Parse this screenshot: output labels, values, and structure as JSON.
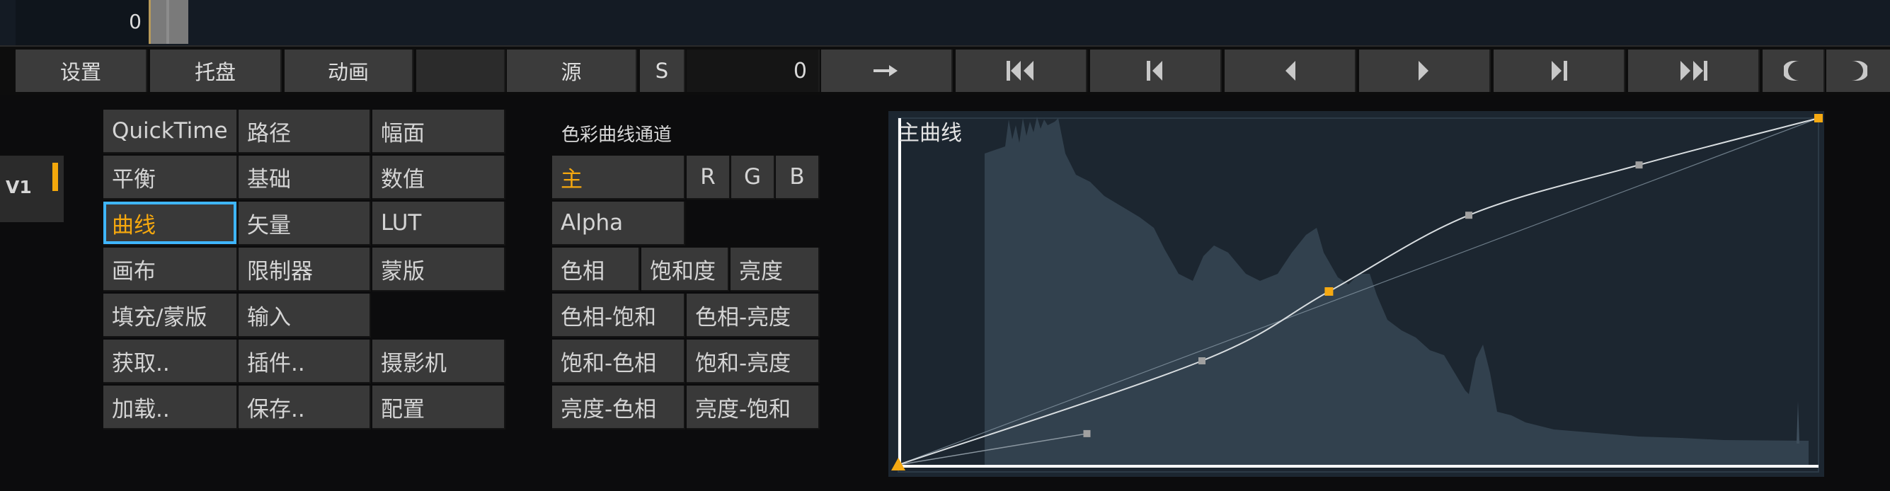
{
  "timeline": {
    "frame": "0"
  },
  "toolbar": {
    "settings": "设置",
    "tray": "托盘",
    "animation": "动画",
    "source": "源",
    "s": "S",
    "field_value": "0",
    "buttons": [
      "arrow-right-icon",
      "skip-to-start-icon",
      "prev-keyframe-icon",
      "prev-frame-icon",
      "next-frame-icon",
      "next-keyframe-icon",
      "skip-to-end-icon",
      "in-point-icon",
      "out-point-icon"
    ]
  },
  "layer": {
    "label": "V1"
  },
  "functions": {
    "quicktime": "QuickTime",
    "path": "路径",
    "frame": "幅面",
    "balance": "平衡",
    "basic": "基础",
    "numeric": "数值",
    "curves": "曲线",
    "vector": "矢量",
    "lut": "LUT",
    "canvas": "画布",
    "limiter": "限制器",
    "mask": "蒙版",
    "fill_mask": "填充/蒙版",
    "input": "输入",
    "grab": "获取..",
    "plugin": "插件..",
    "camera": "摄影机",
    "load": "加载..",
    "save": "保存..",
    "config": "配置",
    "active": "curves",
    "active_color": "#f6a80e",
    "highlight_color": "#3fb6ff"
  },
  "channels": {
    "title": "色彩曲线通道",
    "master": "主",
    "r": "R",
    "g": "G",
    "b": "B",
    "alpha": "Alpha",
    "hue": "色相",
    "saturation": "饱和度",
    "luma": "亮度",
    "hue_sat": "色相-饱和",
    "hue_luma": "色相-亮度",
    "sat_hue": "饱和-色相",
    "sat_luma": "饱和-亮度",
    "luma_hue": "亮度-色相",
    "luma_sat": "亮度-饱和",
    "selected": "master"
  },
  "curve": {
    "title": "主曲线",
    "points": [
      [
        0,
        0
      ],
      [
        0.33,
        0.3
      ],
      [
        0.468,
        0.5
      ],
      [
        0.62,
        0.72
      ],
      [
        0.805,
        0.865
      ],
      [
        1,
        1
      ]
    ],
    "tangent_handles": [
      [
        0.205,
        0.09
      ],
      [
        0.62,
        0.72
      ]
    ],
    "selected_point_color": "#f5a912",
    "point_color": "#a0a0a0"
  }
}
